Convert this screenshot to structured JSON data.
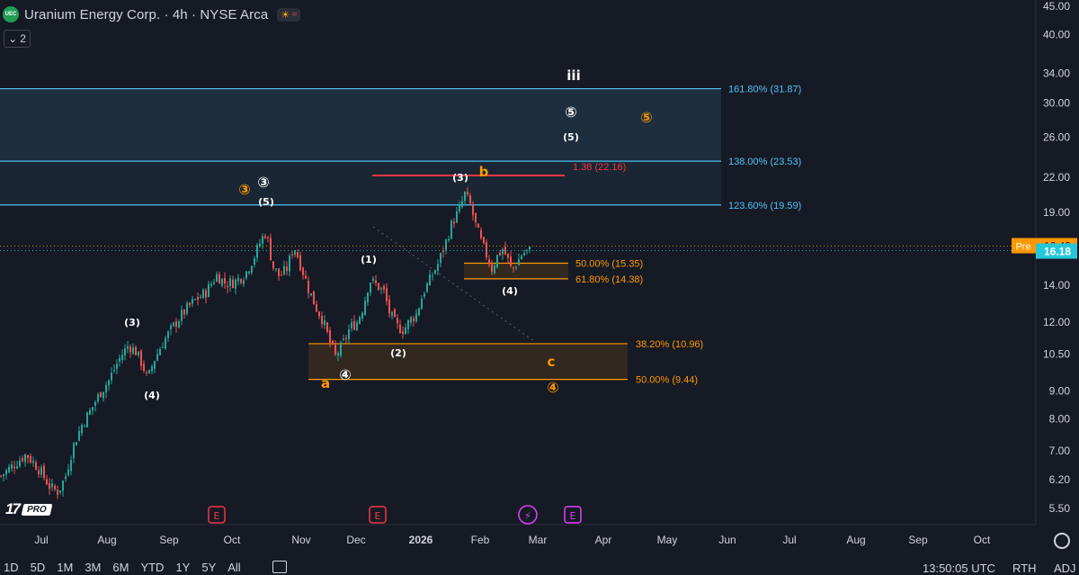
{
  "header": {
    "logo_text": "UEC",
    "title": "Uranium Energy Corp. · 4h · NYSE Arca",
    "collapse_label": "2"
  },
  "branding": {
    "mark": "17",
    "badge": "PRO"
  },
  "bottom_bar": {
    "ranges": [
      "1D",
      "5D",
      "1M",
      "3M",
      "6M",
      "YTD",
      "1Y",
      "5Y",
      "All"
    ],
    "clock": "13:50:05 UTC",
    "session": "RTH",
    "adjust": "ADJ"
  },
  "colors": {
    "bg": "#161a25",
    "up": "#26a69a",
    "down": "#ef5350",
    "cyan": "#4fc3f7",
    "orange": "#ff9800",
    "red": "#f23645",
    "text": "#d1d4dc"
  },
  "chart_data": {
    "type": "candlestick",
    "y_scale": "log",
    "y_ticks": [
      5.5,
      6.2,
      7.0,
      8.0,
      9.0,
      10.5,
      12.0,
      14.0,
      16.18,
      19.0,
      22.0,
      26.0,
      30.0,
      34.0,
      40.0,
      45.0
    ],
    "y_tick_labels": [
      "5.50",
      "6.20",
      "7.00",
      "8.00",
      "9.00",
      "10.50",
      "12.00",
      "14.00",
      "16.18",
      "19.00",
      "22.00",
      "26.00",
      "30.00",
      "34.00",
      "40.00",
      "45.00"
    ],
    "x_ticks": [
      "Jul",
      "Aug",
      "Sep",
      "Oct",
      "Nov",
      "Dec",
      "2026",
      "Feb",
      "Mar",
      "Apr",
      "May",
      "Jun",
      "Jul",
      "Aug",
      "Sep",
      "Oct"
    ],
    "last_price": {
      "label": "16.18",
      "value": 16.18
    },
    "premarket": {
      "tag": "Pre",
      "label": "16.49",
      "value": 16.49
    },
    "price_path": [
      [
        0,
        6.3
      ],
      [
        14,
        6.6
      ],
      [
        28,
        6.9
      ],
      [
        42,
        6.5
      ],
      [
        55,
        6.0
      ],
      [
        64,
        5.9
      ],
      [
        72,
        6.3
      ],
      [
        80,
        7.1
      ],
      [
        90,
        7.8
      ],
      [
        100,
        8.3
      ],
      [
        110,
        8.9
      ],
      [
        120,
        9.4
      ],
      [
        132,
        10.3
      ],
      [
        142,
        10.9
      ],
      [
        150,
        10.6
      ],
      [
        158,
        10.0
      ],
      [
        163,
        9.4
      ],
      [
        170,
        10.2
      ],
      [
        180,
        11.0
      ],
      [
        192,
        11.8
      ],
      [
        205,
        12.6
      ],
      [
        215,
        13.1
      ],
      [
        228,
        13.6
      ],
      [
        240,
        14.6
      ],
      [
        250,
        14.1
      ],
      [
        260,
        14.2
      ],
      [
        272,
        14.7
      ],
      [
        282,
        15.8
      ],
      [
        290,
        17.0
      ],
      [
        295,
        17.5
      ],
      [
        302,
        15.2
      ],
      [
        310,
        14.5
      ],
      [
        318,
        15.0
      ],
      [
        326,
        16.5
      ],
      [
        333,
        15.3
      ],
      [
        342,
        13.8
      ],
      [
        350,
        12.8
      ],
      [
        358,
        12.1
      ],
      [
        366,
        11.0
      ],
      [
        372,
        10.4
      ],
      [
        380,
        10.9
      ],
      [
        388,
        11.7
      ],
      [
        396,
        12.0
      ],
      [
        403,
        12.8
      ],
      [
        410,
        14.3
      ],
      [
        418,
        14.0
      ],
      [
        426,
        13.6
      ],
      [
        432,
        12.5
      ],
      [
        440,
        11.8
      ],
      [
        448,
        11.6
      ],
      [
        455,
        12.1
      ],
      [
        462,
        12.4
      ],
      [
        470,
        13.6
      ],
      [
        478,
        14.4
      ],
      [
        486,
        15.3
      ],
      [
        494,
        16.6
      ],
      [
        502,
        18.2
      ],
      [
        510,
        19.2
      ],
      [
        516,
        20.5
      ],
      [
        522,
        19.6
      ],
      [
        528,
        18.0
      ],
      [
        534,
        16.8
      ],
      [
        540,
        15.9
      ],
      [
        546,
        15.0
      ],
      [
        552,
        15.8
      ],
      [
        558,
        16.3
      ],
      [
        563,
        15.7
      ],
      [
        568,
        14.9
      ],
      [
        574,
        15.4
      ],
      [
        580,
        16.0
      ],
      [
        588,
        16.18
      ]
    ],
    "fib_zones": [
      {
        "label": "161.80% (31.87)",
        "top": 31.87,
        "bottom": 23.53,
        "color": "cyan"
      },
      {
        "label": "138.00% (23.53)",
        "top": 23.53,
        "bottom": 19.59,
        "color": "cyan"
      },
      {
        "label": "123.60% (19.59)",
        "value": 19.59,
        "color": "cyan"
      },
      {
        "label": "50.00% (15.35)",
        "top": 15.35,
        "bottom": 14.38,
        "color": "orange"
      },
      {
        "label": "61.80% (14.38)",
        "value": 14.38,
        "color": "orange"
      },
      {
        "label": "38.20% (10.96)",
        "top": 10.96,
        "bottom": 9.44,
        "color": "orange"
      },
      {
        "label": "50.00% (9.44)",
        "value": 9.44,
        "color": "orange"
      }
    ],
    "red_line": {
      "label": "1.38 (22.16)",
      "value": 22.16
    },
    "wave_labels": [
      {
        "text": "(3)",
        "value": 12.8,
        "color": "white"
      },
      {
        "text": "(4)",
        "value": 9.0,
        "color": "white"
      },
      {
        "text": "③",
        "value": 20.8,
        "color": "orange"
      },
      {
        "text": "③",
        "value": 21.6,
        "color": "white"
      },
      {
        "text": "(5)",
        "value": 19.9,
        "color": "white"
      },
      {
        "text": "(1)",
        "value": 15.7,
        "color": "white"
      },
      {
        "text": "(2)",
        "value": 10.9,
        "color": "white"
      },
      {
        "text": "a",
        "value": 9.2,
        "color": "orange"
      },
      {
        "text": "④",
        "value": 9.4,
        "color": "white"
      },
      {
        "text": "(3)",
        "value": 21.3,
        "color": "white"
      },
      {
        "text": "b",
        "value": 22.3,
        "color": "orange"
      },
      {
        "text": "(4)",
        "value": 13.9,
        "color": "white"
      },
      {
        "text": "c",
        "value": 10.0,
        "color": "orange"
      },
      {
        "text": "④",
        "value": 9.1,
        "color": "orange"
      },
      {
        "text": "iii",
        "value": 35.3,
        "color": "white"
      },
      {
        "text": "⑤",
        "value": 29.3,
        "color": "white"
      },
      {
        "text": "(5)",
        "value": 26.3,
        "color": "white"
      },
      {
        "text": "⑤",
        "value": 28.5,
        "color": "orange"
      }
    ],
    "events": [
      {
        "icon": "E",
        "kind": "earnings",
        "color": "red"
      },
      {
        "icon": "E",
        "kind": "earnings",
        "color": "red"
      },
      {
        "icon": "⚡",
        "kind": "dividend-split",
        "color": "magenta"
      },
      {
        "icon": "E",
        "kind": "earnings",
        "color": "magenta"
      }
    ]
  }
}
